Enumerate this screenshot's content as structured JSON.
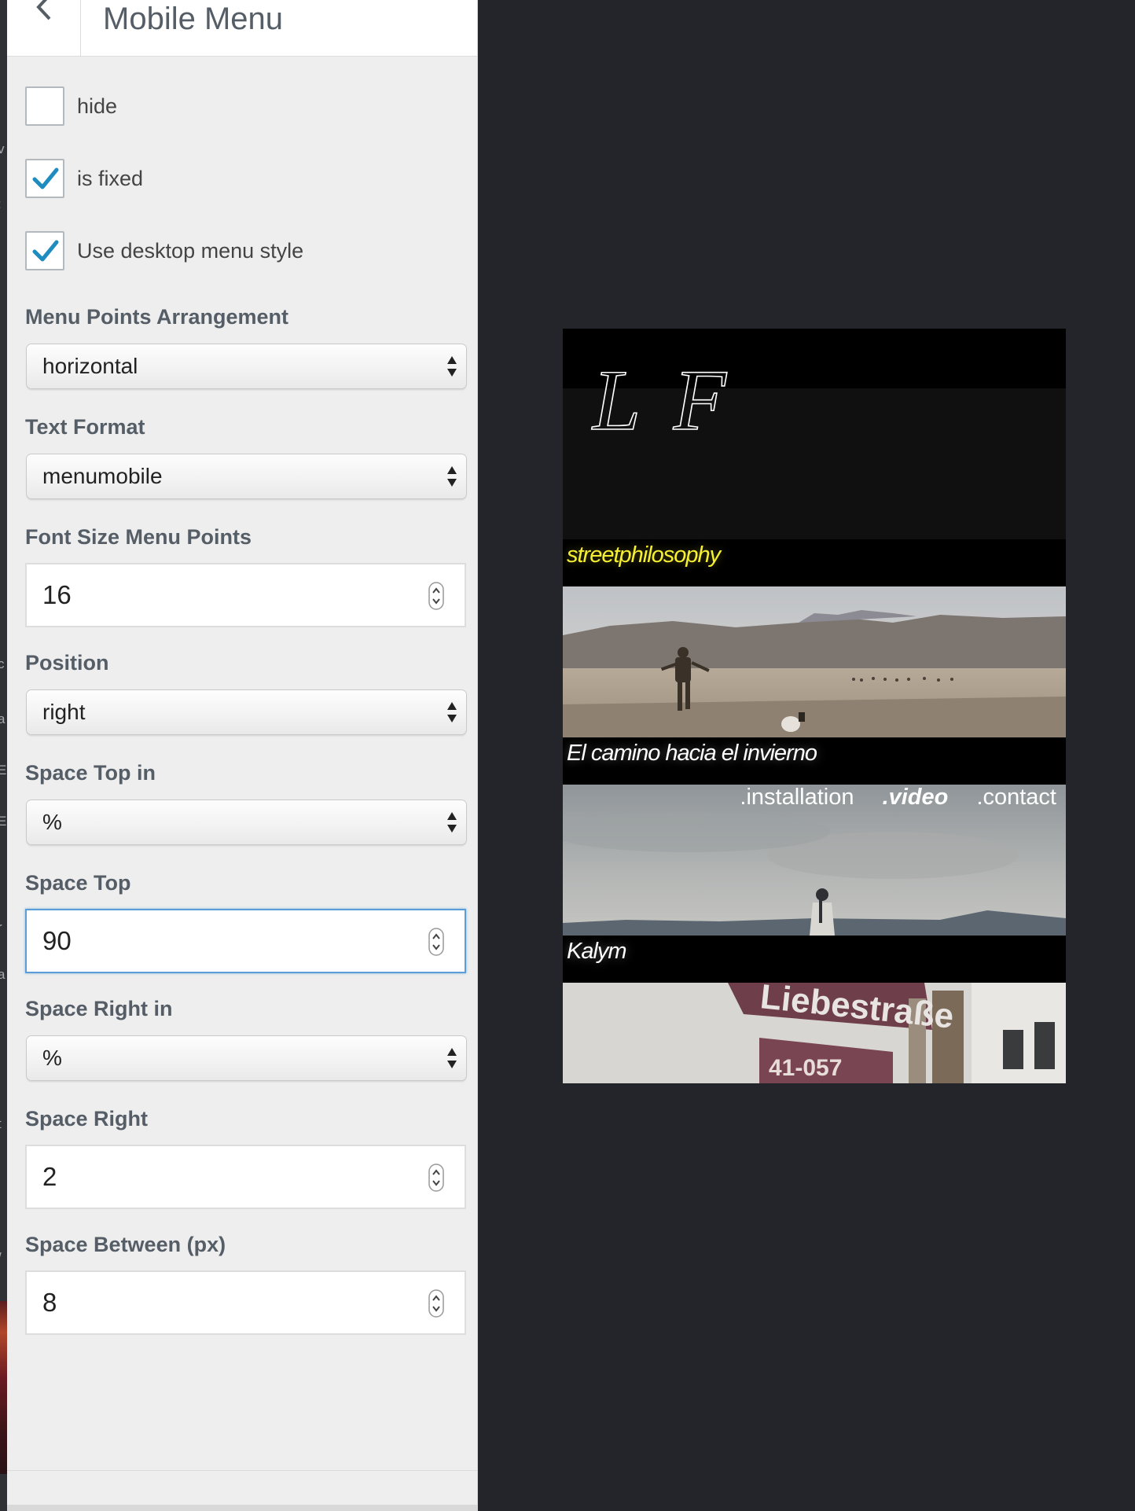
{
  "panel": {
    "title": "Mobile Menu",
    "checkboxes": [
      {
        "label": "hide",
        "checked": false
      },
      {
        "label": "is fixed",
        "checked": true
      },
      {
        "label": "Use desktop menu style",
        "checked": true
      }
    ],
    "fields": {
      "menu_points_arrangement": {
        "label": "Menu Points Arrangement",
        "value": "horizontal"
      },
      "text_format": {
        "label": "Text Format",
        "value": "menumobile"
      },
      "font_size_menu_points": {
        "label": "Font Size Menu Points",
        "value": "16"
      },
      "position": {
        "label": "Position",
        "value": "right"
      },
      "space_top_in": {
        "label": "Space Top in",
        "value": "%"
      },
      "space_top": {
        "label": "Space Top",
        "value": "90"
      },
      "space_right_in": {
        "label": "Space Right in",
        "value": "%"
      },
      "space_right": {
        "label": "Space Right",
        "value": "2"
      },
      "space_between": {
        "label": "Space Between (px)",
        "value": "8"
      }
    }
  },
  "preview": {
    "logo": "L F",
    "projects": [
      {
        "title": "streetphilosophy",
        "highlighted": true
      },
      {
        "title": "El camino hacia el invierno",
        "highlighted": false
      },
      {
        "title": "Kalym",
        "highlighted": false
      }
    ],
    "menu": [
      {
        "label": ".installation",
        "active": false
      },
      {
        "label": ".video",
        "active": true
      },
      {
        "label": ".contact",
        "active": false
      }
    ],
    "sign_text": "Liebestraße",
    "highlight_color": "#f7f032",
    "focus_color": "#5b9dd9",
    "check_color": "#1e8cbe"
  }
}
